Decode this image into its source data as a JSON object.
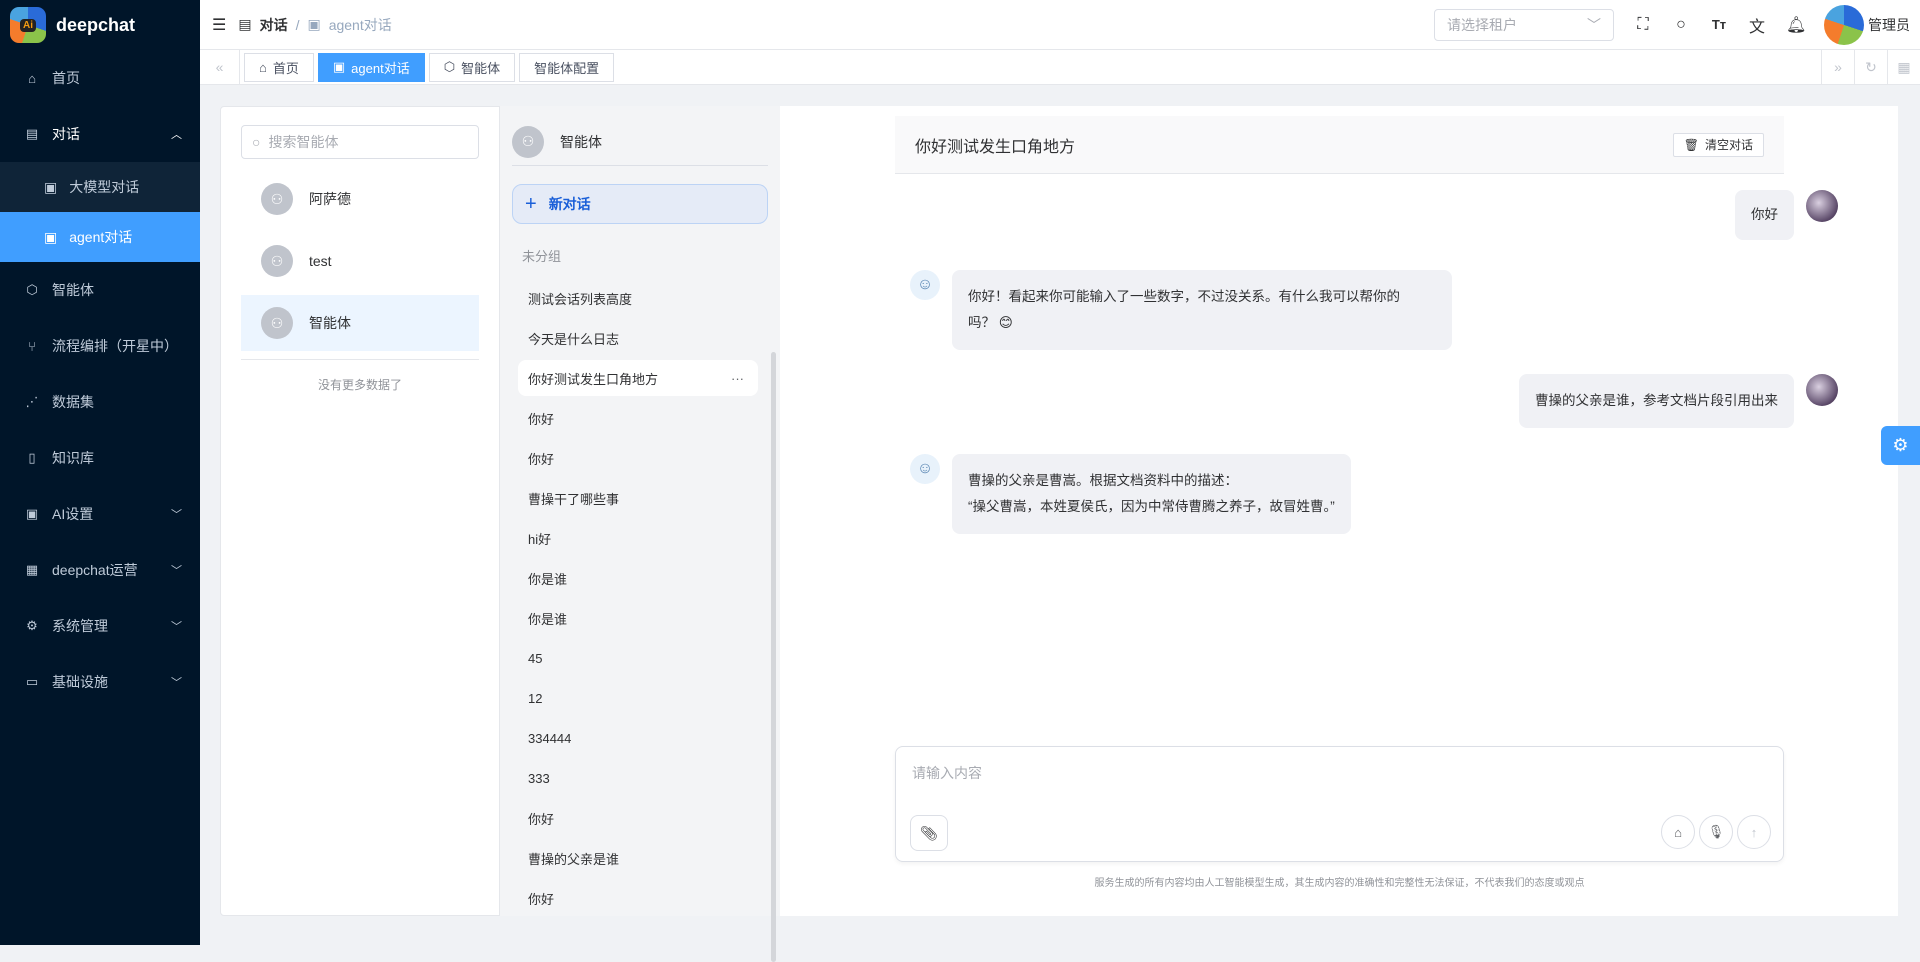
{
  "app": {
    "name": "deepchat",
    "logo_text": "Ai"
  },
  "sidebar": {
    "items": [
      {
        "label": "首页",
        "icon": "home-icon"
      },
      {
        "label": "对话",
        "icon": "chat-icon",
        "expanded": true,
        "children": [
          {
            "label": "大模型对话"
          },
          {
            "label": "agent对话",
            "active": true
          }
        ]
      },
      {
        "label": "智能体",
        "icon": "chip-icon"
      },
      {
        "label": "流程编排（开星中）",
        "icon": "branch-icon"
      },
      {
        "label": "数据集",
        "icon": "chart-icon"
      },
      {
        "label": "知识库",
        "icon": "book-icon"
      },
      {
        "label": "AI设置",
        "icon": "settings-panel-icon"
      },
      {
        "label": "deepchat运营",
        "icon": "grid-icon"
      },
      {
        "label": "系统管理",
        "icon": "gear-icon"
      },
      {
        "label": "基础设施",
        "icon": "monitor-icon"
      }
    ]
  },
  "header": {
    "breadcrumb": [
      "对话",
      "agent对话"
    ],
    "tenant_placeholder": "请选择租户",
    "user": "管理员"
  },
  "tabs": [
    {
      "label": "首页"
    },
    {
      "label": "agent对话",
      "active": true
    },
    {
      "label": "智能体"
    },
    {
      "label": "智能体配置"
    }
  ],
  "agents": {
    "search_placeholder": "搜索智能体",
    "items": [
      "阿萨德",
      "test",
      "智能体"
    ],
    "active": 2,
    "no_more": "没有更多数据了"
  },
  "conversations": {
    "agent_name": "智能体",
    "new_chat": "新对话",
    "group": "未分组",
    "items": [
      "测试会话列表高度",
      "今天是什么日志",
      "你好测试发生口角地方",
      "你好",
      "你好",
      "曹操干了哪些事",
      "hi好",
      "你是谁",
      "你是谁",
      "45",
      "12",
      "334444",
      "333",
      "你好",
      "曹操的父亲是谁",
      "你好"
    ],
    "active": 2
  },
  "chat": {
    "title": "你好测试发生口角地方",
    "clear_label": "清空对话",
    "messages": [
      {
        "role": "user",
        "text": "你好"
      },
      {
        "role": "bot",
        "text": "你好！看起来你可能输入了一些数字，不过没关系。有什么我可以帮你的",
        "text2": "吗？ 😊"
      },
      {
        "role": "user",
        "text": "曹操的父亲是谁，参考文档片段引用出来"
      },
      {
        "role": "bot",
        "text": "曹操的父亲是曹嵩。根据文档资料中的描述：",
        "text2": "“操父曹嵩，本姓夏侯氏，因为中常侍曹腾之养子，故冒姓曹。”"
      }
    ],
    "input_placeholder": "请输入内容",
    "disclaimer": "服务生成的所有内容均由人工智能模型生成，其生成内容的准确性和完整性无法保证，不代表我们的态度或观点"
  }
}
